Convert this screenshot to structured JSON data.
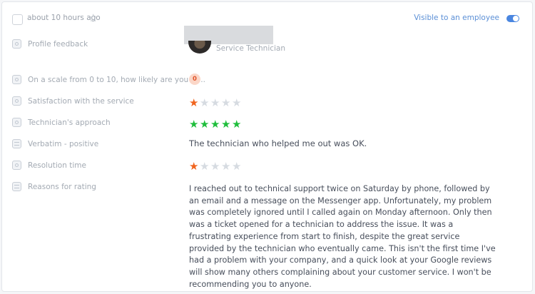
{
  "header": {
    "timestamp": "about 10 hours ago",
    "visibility_label": "Visible to an employee",
    "visibility_on": true
  },
  "technician": {
    "role": "Service Technician"
  },
  "fields": [
    {
      "label": "Profile feedback",
      "icon": "person-icon"
    },
    {
      "label": "On a scale from 0 to 10, how likely are you to...",
      "icon": "scale-icon",
      "value": "0"
    },
    {
      "label": "Satisfaction with the service",
      "icon": "rating-icon",
      "rating": 1,
      "max": 5
    },
    {
      "label": "Technician's approach",
      "icon": "rating-icon",
      "rating": 5,
      "max": 5
    },
    {
      "label": "Verbatim - positive",
      "icon": "text-icon",
      "value": "The technician who helped me out was OK."
    },
    {
      "label": "Resolution time",
      "icon": "rating-icon",
      "rating": 1,
      "max": 5
    },
    {
      "label": "Reasons for rating",
      "icon": "text-icon",
      "value": "I reached out to technical support twice on Saturday by phone, followed by an email and a message on the Messenger app. Unfortunately, my problem was completely ignored until I called again on Monday afternoon. Only then was a ticket opened for a technician to address the issue. It was a frustrating experience from start to finish, despite the great service provided by the technician who eventually came. This isn't the first time I've had a problem with your company, and a quick look at your Google reviews will show many others complaining about your customer service. I won't be recommending you to anyone."
    }
  ],
  "colors": {
    "star_low": "#f0641e",
    "star_high": "#1fbe3c",
    "star_empty": "#d6dbe1",
    "accent": "#4a86e0"
  }
}
